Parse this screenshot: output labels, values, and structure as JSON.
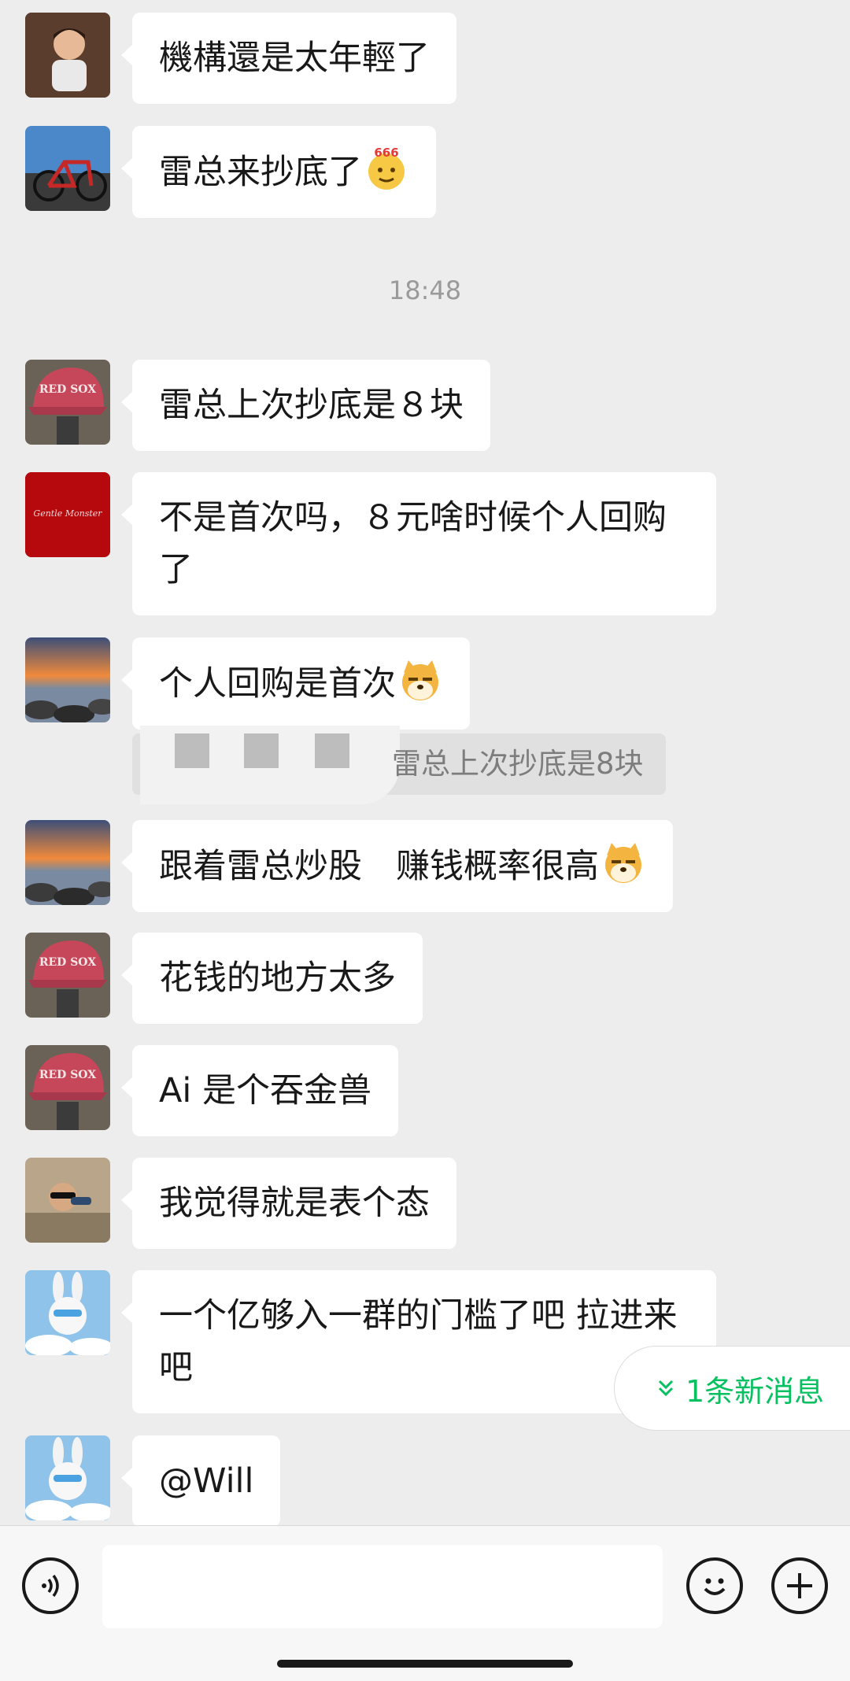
{
  "colors": {
    "background": "#ededed",
    "bubble": "#ffffff",
    "accent": "#07c160"
  },
  "messages": [
    {
      "text": "機構還是太年輕了",
      "avatar": "cartoon-boy-avatar"
    },
    {
      "text": "雷总来抄底了",
      "avatar": "bicycle-avatar",
      "emoji": "666-emoji"
    },
    {
      "text": "雷总上次抄底是８块",
      "avatar": "red-sox-cap-avatar"
    },
    {
      "text": "不是首次吗，８元啥时候个人回购了",
      "avatar": "gentle-monster-avatar",
      "avatar_text": "Gentle Monster"
    },
    {
      "text": "个人回购是首次",
      "avatar": "sunset-beach-avatar",
      "emoji": "doge-emoji"
    },
    {
      "text": "跟着雷总炒股　赚钱概率很高",
      "avatar": "sunset-beach-avatar",
      "emoji": "doge-emoji"
    },
    {
      "text": "花钱的地方太多",
      "avatar": "red-sox-cap-avatar"
    },
    {
      "text": "Ai 是个吞金兽",
      "avatar": "red-sox-cap-avatar"
    },
    {
      "text": "我觉得就是表个态",
      "avatar": "sunglasses-man-avatar"
    },
    {
      "text": "一个亿够入一群的门槛了吧 拉进来吧",
      "avatar": "white-rabbit-avatar"
    },
    {
      "text": "@Will",
      "avatar": "white-rabbit-avatar"
    }
  ],
  "timestamp": "18:48",
  "quote": {
    "text": "雷总上次抄底是8块"
  },
  "new_messages": {
    "label": "1条新消息",
    "icon": "double-chevron-down-icon"
  },
  "input_bar": {
    "voice_icon": "voice-icon",
    "emoji_icon": "emoji-icon",
    "plus_icon": "plus-icon",
    "value": ""
  }
}
